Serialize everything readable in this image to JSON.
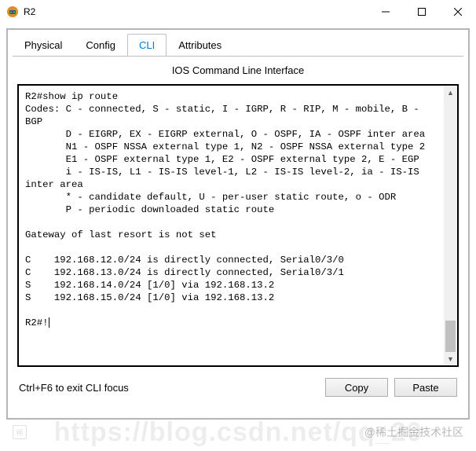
{
  "window": {
    "title": "R2"
  },
  "tabs": {
    "physical": "Physical",
    "config": "Config",
    "cli": "CLI",
    "attributes": "Attributes"
  },
  "subtitle": "IOS Command Line Interface",
  "terminal": "R2#show ip route\nCodes: C - connected, S - static, I - IGRP, R - RIP, M - mobile, B - BGP\n       D - EIGRP, EX - EIGRP external, O - OSPF, IA - OSPF inter area\n       N1 - OSPF NSSA external type 1, N2 - OSPF NSSA external type 2\n       E1 - OSPF external type 1, E2 - OSPF external type 2, E - EGP\n       i - IS-IS, L1 - IS-IS level-1, L2 - IS-IS level-2, ia - IS-IS inter area\n       * - candidate default, U - per-user static route, o - ODR\n       P - periodic downloaded static route\n\nGateway of last resort is not set\n\nC    192.168.12.0/24 is directly connected, Serial0/3/0\nC    192.168.13.0/24 is directly connected, Serial0/3/1\nS    192.168.14.0/24 [1/0] via 192.168.13.2\nS    192.168.15.0/24 [1/0] via 192.168.13.2\n\nR2#!",
  "footer": {
    "hint": "Ctrl+F6 to exit CLI focus",
    "copy": "Copy",
    "paste": "Paste"
  },
  "watermark": {
    "bg": "https://blog.csdn.net/qq_20",
    "left": "稀",
    "right": "@稀土掘金技术社区"
  }
}
